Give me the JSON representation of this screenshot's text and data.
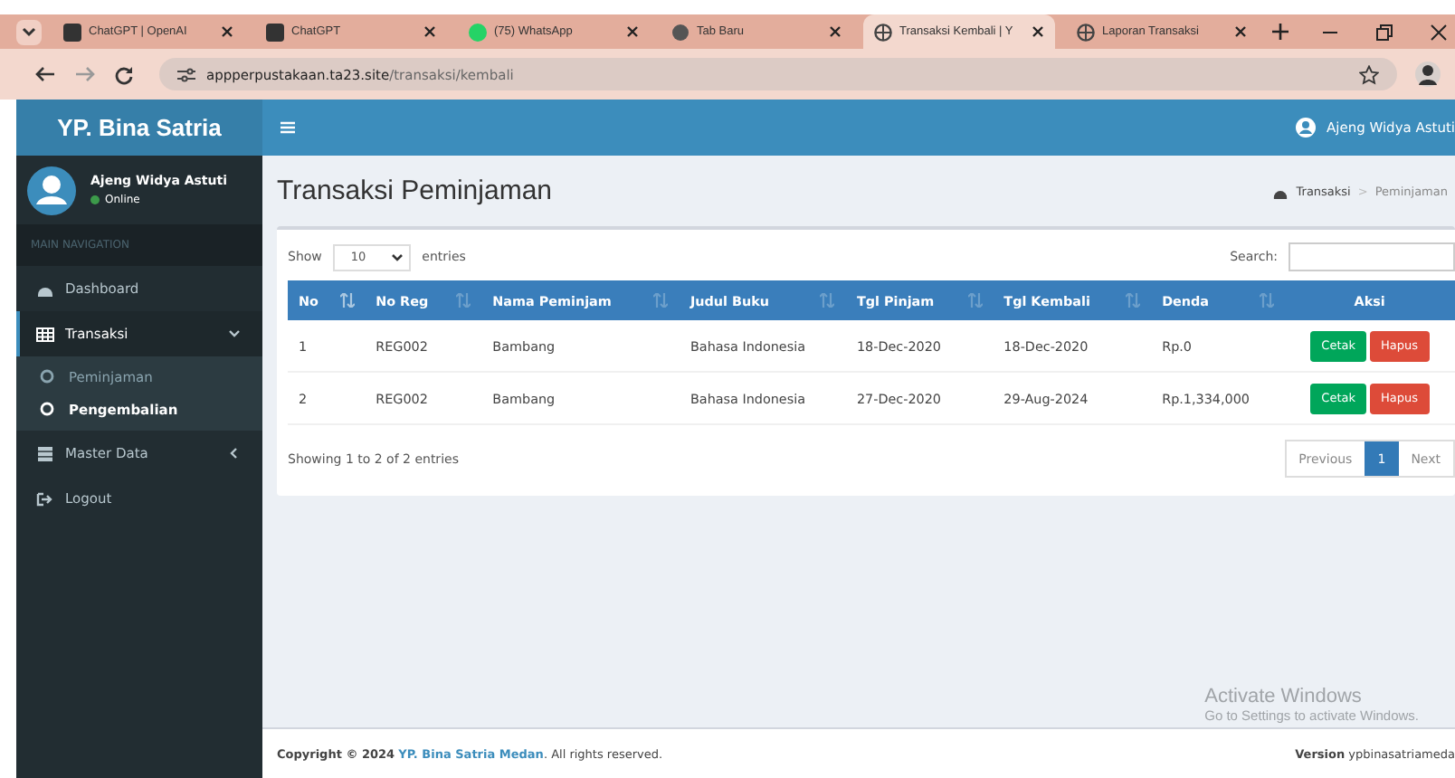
{
  "browser": {
    "tabs": [
      {
        "title": "ChatGPT | OpenAI",
        "kind": "square",
        "selected": false
      },
      {
        "title": "ChatGPT",
        "kind": "square",
        "selected": false
      },
      {
        "title": "(75) WhatsApp",
        "kind": "chat",
        "selected": false
      },
      {
        "title": "Tab Baru",
        "kind": "dot",
        "selected": false
      },
      {
        "title": "Transaksi Kembali | Y",
        "kind": "globe",
        "selected": true
      },
      {
        "title": "Laporan Transaksi",
        "kind": "globe",
        "selected": false
      }
    ],
    "url_host": "appperpustakaan.ta23.site",
    "url_path": "/transaksi/kembali"
  },
  "app": {
    "logo": "YP. Bina Satria",
    "user_name": "Ajeng Widya Astuti",
    "user_status": "Online",
    "nav_header": "MAIN NAVIGATION",
    "nav": [
      {
        "label": "Dashboard",
        "kind": "dashboard",
        "selected": false
      },
      {
        "label": "Transaksi",
        "kind": "table",
        "expandable": true,
        "expanded": true,
        "selected": true,
        "children": [
          {
            "label": "Peminjaman",
            "selected": false
          },
          {
            "label": "Pengembalian",
            "selected": true
          }
        ]
      },
      {
        "label": "Master Data",
        "kind": "database",
        "expandable": true,
        "expanded": false,
        "selected": false
      },
      {
        "label": "Logout",
        "kind": "logout",
        "selected": false
      }
    ],
    "header_user": "Ajeng Widya Astuti"
  },
  "page": {
    "title": "Transaksi Peminjaman",
    "breadcrumb": [
      "Transaksi",
      "Peminjaman"
    ],
    "breadcrumb_separator": ">",
    "show_label": "Show",
    "page_size": "10",
    "entries_label": "entries",
    "search_label": "Search:",
    "columns": [
      {
        "label": "No",
        "sorted": true
      },
      {
        "label": "No Reg",
        "sorted": false
      },
      {
        "label": "Nama Peminjam",
        "sorted": false
      },
      {
        "label": "Judul Buku",
        "sorted": false
      },
      {
        "label": "Tgl Pinjam",
        "sorted": false
      },
      {
        "label": "Tgl Kembali",
        "sorted": false
      },
      {
        "label": "Denda",
        "sorted": false
      },
      {
        "label": "Aksi"
      }
    ],
    "rows": [
      {
        "cells": [
          "1",
          "REG002",
          "Bambang",
          "Bahasa Indonesia",
          "18-Dec-2020",
          "18-Dec-2020",
          "Rp.0"
        ],
        "actions": [
          "Cetak",
          "Hapus"
        ]
      },
      {
        "cells": [
          "2",
          "REG002",
          "Bambang",
          "Bahasa Indonesia",
          "27-Dec-2020",
          "29-Aug-2024",
          "Rp.1,334,000"
        ],
        "actions": [
          "Cetak",
          "Hapus"
        ]
      }
    ],
    "info": "Showing 1 to 2 of 2 entries",
    "pagination": [
      {
        "label": "Previous",
        "selected": false
      },
      {
        "label": "1",
        "selected": true
      },
      {
        "label": "Next",
        "selected": false
      }
    ]
  },
  "footer": {
    "copy_lead": "Copyright © 2024",
    "copy_link": "YP. Bina Satria Medan",
    "copy_tail": ". All rights reserved.",
    "version_label": "Version",
    "version": "ypbinasatriameda"
  },
  "os_overlay": {
    "title": "Activate Windows",
    "subtitle": "Go to Settings to activate Windows."
  }
}
